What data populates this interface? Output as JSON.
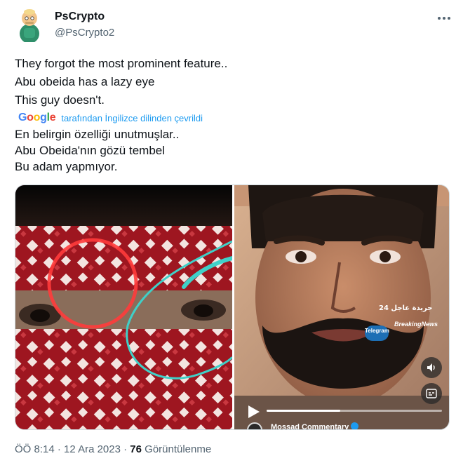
{
  "author": {
    "name": "PsCrypto",
    "handle": "@PsCrypto2"
  },
  "tweet": {
    "lines": [
      "They forgot the most prominent feature..",
      "Abu obeida has a lazy eye",
      "This guy doesn't."
    ],
    "translation_notice": "tarafından İngilizce dilinden çevrildi",
    "google_logo_letters": [
      "G",
      "o",
      "o",
      "g",
      "l",
      "e"
    ],
    "translated_lines": [
      "En belirgin özelliği unutmuşlar..",
      "Abu Obeida'nın gözü tembel",
      "Bu adam yapmıyor."
    ]
  },
  "media": {
    "watermark_arabic": "جريدة عاجل 24",
    "watermark_breaking": "BreakingNews",
    "watermark_telegram": "Telegram",
    "channel_name": "Mossad Commentary",
    "video_progress_fraction": 0.42
  },
  "footer": {
    "time": "ÖÖ 8:14",
    "sep1": " · ",
    "date": "12 Ara 2023",
    "sep2": " · ",
    "views_count": "76",
    "views_label": " Görüntülenme"
  },
  "colors": {
    "accent": "#1d9bf0",
    "secondary_text": "#536471",
    "primary_text": "#0f1419"
  },
  "icons": {
    "avatar": "cartoon-avatar-icon",
    "more": "more-options-icon",
    "sound": "speaker-icon",
    "captions": "captions-icon",
    "play": "play-icon",
    "verified": "verified-badge-icon"
  }
}
